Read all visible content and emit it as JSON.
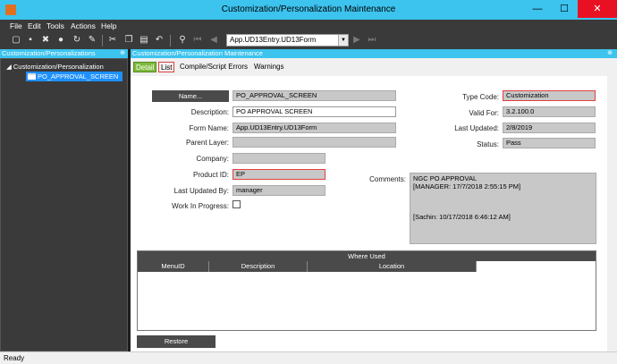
{
  "window": {
    "title": "Customization/Personalization Maintenance",
    "minimize": "—",
    "maximize": "☐",
    "close": "✕"
  },
  "menu": [
    "File",
    "Edit",
    "Tools",
    "Actions",
    "Help"
  ],
  "toolbar": {
    "form_combo_value": "App.UD13Entry.UD13Form"
  },
  "left_panel": {
    "header": "Customization/Personalizations",
    "pin": "⊕",
    "tree_root": "Customization/Personalization",
    "tree_child": "PO_APPROVAL_SCREEN"
  },
  "main_panel": {
    "header": "Customization/Personalization Maintenance",
    "pin": "⊕",
    "tabs": [
      "Detail",
      "List",
      "Compile/Script Errors",
      "Warnings"
    ]
  },
  "form": {
    "name_button": "Name...",
    "name_value": "PO_APPROVAL_SCREEN",
    "description_label": "Description:",
    "description_value": "PO APPROVAL SCREEN",
    "form_name_label": "Form Name:",
    "form_name_value": "App.UD13Entry.UD13Form",
    "parent_layer_label": "Parent Layer:",
    "parent_layer_value": "",
    "company_label": "Company:",
    "company_value": "",
    "product_id_label": "Product ID:",
    "product_id_value": "EP",
    "last_updated_by_label": "Last Updated By:",
    "last_updated_by_value": "manager",
    "work_in_progress_label": "Work In Progress:",
    "type_code_label": "Type Code:",
    "type_code_value": "Customization",
    "valid_for_label": "Valid For:",
    "valid_for_value": "3.2.100.0",
    "last_updated_label": "Last Updated:",
    "last_updated_value": "2/8/2019",
    "status_label": "Status:",
    "status_value": "Pass",
    "comments_label": "Comments:",
    "comments_value": "NGC PO APPROVAL\n[MANAGER: 17/7/2018 2:55:15 PM]\n\n\n\n[Sachin: 10/17/2018 6:46:12 AM]"
  },
  "where_used": {
    "title": "Where Used",
    "columns": [
      "MenuID",
      "Description",
      "Location"
    ]
  },
  "restore_button": "Restore",
  "status_bar": "Ready"
}
